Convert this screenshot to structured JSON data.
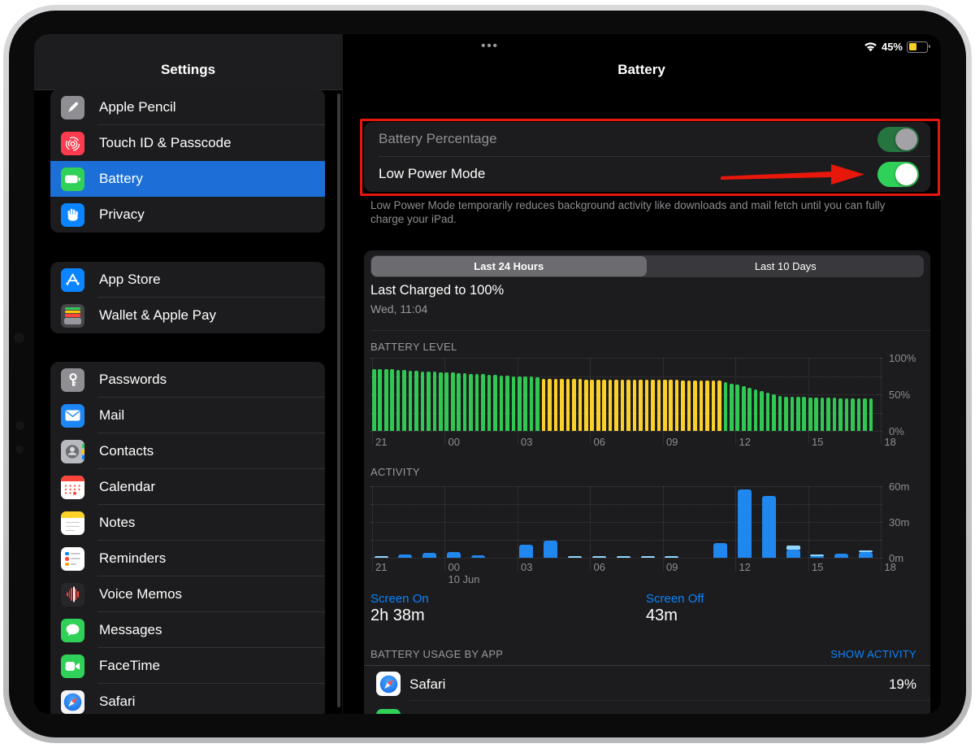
{
  "status_bar": {
    "battery_label": "45%",
    "battery_fill_percent": 45,
    "battery_fill_color": "#f6ce2a",
    "wifi_icon": "wifi-icon"
  },
  "sidebar": {
    "title": "Settings",
    "groups": [
      {
        "items": [
          {
            "label": "Apple Pencil",
            "icon": "pencil-icon",
            "icon_bg": "#8e8e93"
          },
          {
            "label": "Touch ID & Passcode",
            "icon": "fingerprint-icon",
            "icon_bg": "#fc3b4e"
          },
          {
            "label": "Battery",
            "icon": "battery-icon",
            "icon_bg": "#30d158",
            "selected": true
          },
          {
            "label": "Privacy",
            "icon": "hand-icon",
            "icon_bg": "#0a84ff"
          }
        ]
      },
      {
        "items": [
          {
            "label": "App Store",
            "icon": "appstore-icon",
            "icon_bg": "#0a84ff"
          },
          {
            "label": "Wallet & Apple Pay",
            "icon": "wallet-icon",
            "icon_bg": "#47474b"
          }
        ]
      },
      {
        "items": [
          {
            "label": "Passwords",
            "icon": "key-icon",
            "icon_bg": "#8e8e93"
          },
          {
            "label": "Mail",
            "icon": "mail-icon",
            "icon_bg": "#1d86f5"
          },
          {
            "label": "Contacts",
            "icon": "contacts-icon",
            "icon_bg": "#b9b9c0"
          },
          {
            "label": "Calendar",
            "icon": "calendar-icon",
            "icon_bg": "#ffffff"
          },
          {
            "label": "Notes",
            "icon": "notes-icon",
            "icon_bg": "#ffffff"
          },
          {
            "label": "Reminders",
            "icon": "reminders-icon",
            "icon_bg": "#ffffff"
          },
          {
            "label": "Voice Memos",
            "icon": "voicememos-icon",
            "icon_bg": "#27272a"
          },
          {
            "label": "Messages",
            "icon": "messages-icon",
            "icon_bg": "#30d158"
          },
          {
            "label": "FaceTime",
            "icon": "facetime-icon",
            "icon_bg": "#30d158"
          },
          {
            "label": "Safari",
            "icon": "safari-icon",
            "icon_bg": "#f4f4f7"
          }
        ]
      }
    ]
  },
  "detail": {
    "nav_title": "Battery",
    "multitask_dots": "•••",
    "toggle_rows": [
      {
        "label": "Battery Percentage",
        "name": "battery-percentage-toggle",
        "state": "on-disabled",
        "label_color": "#8f8f95"
      },
      {
        "label": "Low Power Mode",
        "name": "low-power-mode-toggle",
        "state": "on",
        "label_color": "#ffffff"
      }
    ],
    "annotation": {
      "color": "#e8170b",
      "arrow": "red-arrow",
      "box": "red-box"
    },
    "footer_text": "Low Power Mode temporarily reduces background activity like downloads and mail fetch until you can fully charge your iPad.",
    "segmented": {
      "options": [
        "Last 24 Hours",
        "Last 10 Days"
      ],
      "selected_index": 0
    },
    "last_charged": {
      "title": "Last Charged to 100%",
      "subtitle": "Wed, 11:04"
    },
    "screen_stats": [
      {
        "label": "Screen On",
        "value": "2h 38m"
      },
      {
        "label": "Screen Off",
        "value": "43m"
      }
    ],
    "usage": {
      "header": "BATTERY USAGE BY APP",
      "action": "SHOW ACTIVITY",
      "rows": [
        {
          "app": "Safari",
          "icon": "safari-icon",
          "percent": "19%"
        }
      ],
      "partial_next_row": {
        "icon_color": "#30d158"
      }
    }
  },
  "chart_data": [
    {
      "type": "bar",
      "title": "BATTERY LEVEL",
      "ylim": [
        0,
        100
      ],
      "y_tick_labels": [
        "100%",
        "50%",
        "0%"
      ],
      "x_ticks": [
        "21",
        "00",
        "03",
        "06",
        "09",
        "12",
        "15",
        "18"
      ],
      "bar_interval_minutes": 15,
      "start_hour": 21,
      "colors": {
        "normal": "#30c753",
        "low_power": "#fcd02a"
      },
      "yellow_range": [
        28,
        57
      ],
      "levels": [
        85,
        84.5,
        84,
        84,
        83.5,
        83,
        82.5,
        82,
        81.5,
        81,
        81,
        80.5,
        80,
        79.5,
        79,
        78.5,
        78,
        78,
        77.5,
        77,
        76.5,
        76,
        75.5,
        75,
        75,
        74.5,
        74,
        73.5,
        71,
        70.9,
        70.9,
        70.8,
        70.7,
        70.7,
        70.6,
        70.5,
        70.4,
        70.4,
        70.3,
        70.2,
        70.2,
        70.1,
        70,
        70,
        69.9,
        69.8,
        69.7,
        69.7,
        69.6,
        69.5,
        69.5,
        69.4,
        69.3,
        69.2,
        69.2,
        69.1,
        69,
        69,
        67,
        64.9,
        62.8,
        60.7,
        58.6,
        56.4,
        54.3,
        52.2,
        50.1,
        48,
        47,
        46.8,
        46.6,
        46.4,
        46.1,
        45.9,
        45.7,
        45.5,
        45.2,
        45,
        44.8,
        44.6,
        44.4,
        44.1,
        44
      ]
    },
    {
      "type": "bar",
      "title": "ACTIVITY",
      "ylim": [
        0,
        60
      ],
      "y_tick_labels": [
        "60m",
        "30m",
        "0m"
      ],
      "x_ticks": [
        "21",
        "00",
        "03",
        "06",
        "09",
        "12",
        "15",
        "18"
      ],
      "sub_label": "10 Jun",
      "sub_label_tick_index": 1,
      "colors": {
        "screen_on": "#1f87ee",
        "screen_off": "#90d6fe"
      },
      "hours": [
        "21",
        "22",
        "23",
        "00",
        "01",
        "02",
        "03",
        "04",
        "05",
        "06",
        "07",
        "08",
        "09",
        "10",
        "11",
        "12",
        "13",
        "14",
        "15",
        "16",
        "17"
      ],
      "series": [
        {
          "name": "screen_on_minutes",
          "values": [
            0,
            3,
            4,
            5,
            2,
            0,
            11,
            14,
            0,
            0,
            0,
            0,
            0,
            0,
            12,
            57,
            52,
            7,
            1.5,
            3.5,
            4.5
          ]
        },
        {
          "name": "screen_off_minutes",
          "values": [
            1.5,
            0,
            0,
            0,
            0,
            0,
            0,
            0,
            1,
            1,
            1,
            1.2,
            1,
            0,
            0,
            0,
            0,
            3,
            1.5,
            0,
            1.5
          ]
        }
      ]
    }
  ]
}
